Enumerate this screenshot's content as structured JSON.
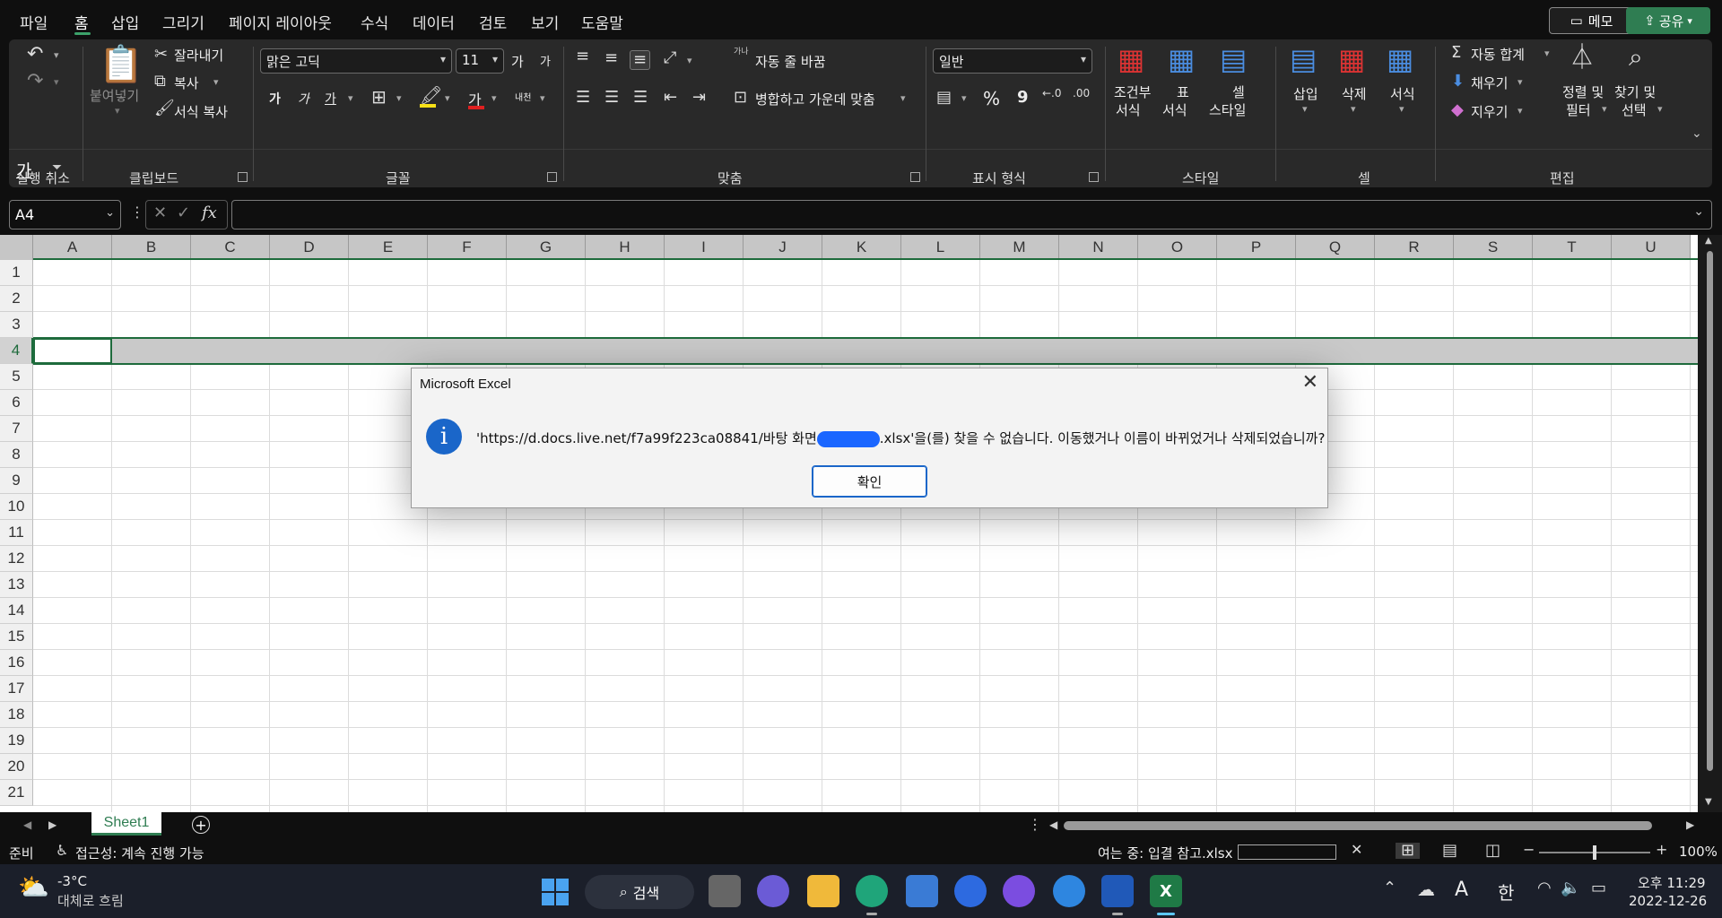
{
  "menu": {
    "items": [
      "파일",
      "홈",
      "삽입",
      "그리기",
      "페이지 레이아웃",
      "수식",
      "데이터",
      "검토",
      "보기",
      "도움말"
    ],
    "memo_label": "메모",
    "share_label": "공유"
  },
  "ribbon": {
    "undo_label": "실행 취소",
    "clipboard": {
      "label": "클립보드",
      "paste": "붙여넣기",
      "cut": "잘라내기",
      "copy": "복사",
      "format_painter": "서식 복사"
    },
    "font": {
      "label": "글꼴",
      "name": "맑은 고딕",
      "size": "11",
      "bold": "가",
      "italic": "가",
      "underline": "가",
      "grow": "가",
      "shrink": "가",
      "color_a": "가",
      "phonetic": "내천"
    },
    "alignment": {
      "label": "맞춤",
      "wrap": "자동 줄 바꿈",
      "merge": "병합하고 가운데 맞춤",
      "wrap_icon": "가나"
    },
    "number": {
      "label": "표시 형식",
      "format": "일반",
      "percent": "%",
      "comma": "9",
      "inc_decimal": "←.0\n.00",
      "dec_decimal": ".00\n→.0"
    },
    "styles": {
      "label": "스타일",
      "conditional": [
        "조건부",
        "서식"
      ],
      "table": [
        "표",
        "서식"
      ],
      "cell": [
        "셀",
        "스타일"
      ]
    },
    "cells": {
      "label": "셀",
      "insert": "삽입",
      "delete": "삭제",
      "format": "서식"
    },
    "editing": {
      "label": "편집",
      "autosum": "자동 합계",
      "fill": "채우기",
      "clear": "지우기",
      "sort": [
        "정렬 및",
        "필터"
      ],
      "find": [
        "찾기 및",
        "선택"
      ]
    }
  },
  "qat": {
    "label": "가"
  },
  "formula_bar": {
    "name_box": "A4",
    "fx": "fx",
    "value": ""
  },
  "grid": {
    "columns": [
      "A",
      "B",
      "C",
      "D",
      "E",
      "F",
      "G",
      "H",
      "I",
      "J",
      "K",
      "L",
      "M",
      "N",
      "O",
      "P",
      "Q",
      "R",
      "S",
      "T",
      "U"
    ],
    "rows": [
      "1",
      "2",
      "3",
      "4",
      "5",
      "6",
      "7",
      "8",
      "9",
      "10",
      "11",
      "12",
      "13",
      "14",
      "15",
      "16",
      "17",
      "18",
      "19",
      "20",
      "21"
    ],
    "selected_row": "4"
  },
  "sheets": {
    "tabs": [
      "Sheet1"
    ],
    "active": "Sheet1"
  },
  "status": {
    "ready": "준비",
    "accessibility": "접근성: 계속 진행 가능",
    "opening": "여는 중: 입결 참고.xlsx",
    "zoom": "100%"
  },
  "dialog": {
    "title": "Microsoft Excel",
    "message_prefix": "'https://d.docs.live.net/f7a99f223ca08841/바탕 화면",
    "message_suffix": ".xlsx'을(를) 찾을 수 없습니다. 이동했거나 이름이 바뀌었거나 삭제되었습니까?",
    "ok_label": "확인",
    "info_glyph": "i"
  },
  "taskbar": {
    "temp": "-3°C",
    "weather": "대체로 흐림",
    "search": "검색",
    "time": "오후 11:29",
    "date": "2022-12-26",
    "ime_a": "A",
    "ime_han": "한"
  }
}
